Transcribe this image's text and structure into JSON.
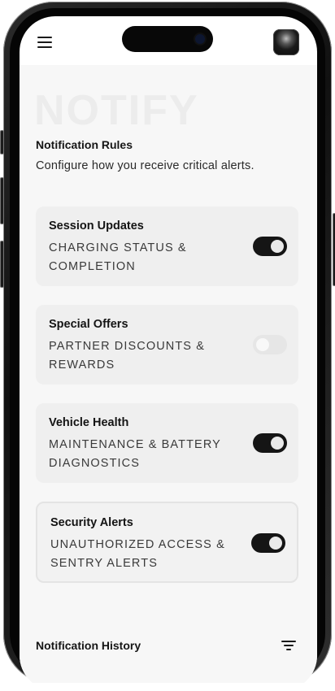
{
  "app": {
    "watermark": "NOTIFY"
  },
  "header": {
    "menu_icon": "hamburger-menu-icon",
    "avatar_icon": "user-avatar"
  },
  "rules": {
    "title": "Notification Rules",
    "subtitle": "Configure how you receive critical alerts."
  },
  "cards": [
    {
      "title": "Session Updates",
      "description": "CHARGING STATUS & COMPLETION",
      "enabled": true
    },
    {
      "title": "Special Offers",
      "description": "PARTNER DISCOUNTS & REWARDS",
      "enabled": false
    },
    {
      "title": "Vehicle Health",
      "description": "MAINTENANCE & BATTERY DIAGNOSTICS",
      "enabled": true
    },
    {
      "title": "Security Alerts",
      "description": "UNAUTHORIZED ACCESS & SENTRY ALERTS",
      "enabled": true
    }
  ],
  "history": {
    "title": "Notification History",
    "filter_icon": "filter-icon"
  },
  "colors": {
    "toggle_on": "#151515",
    "toggle_off": "#e6e6e6",
    "card_bg": "#efefef",
    "page_bg": "#f7f7f7"
  }
}
